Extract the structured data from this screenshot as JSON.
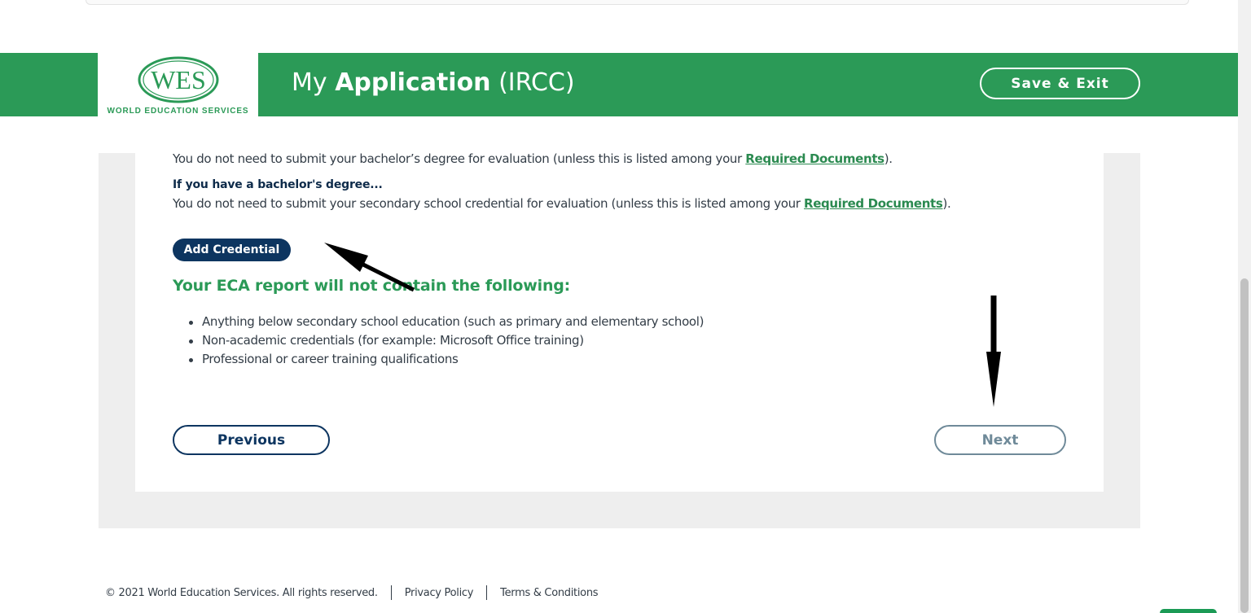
{
  "header": {
    "logo_text": "WES",
    "logo_subtitle": "WORLD EDUCATION SERVICES",
    "title_prefix": "My ",
    "title_bold": "Application",
    "title_suffix": " (IRCC)",
    "save_exit_label": "Save & Exit",
    "brand_color": "#2b9a57"
  },
  "content": {
    "line1_text": "You do not need to submit your bachelor’s degree for evaluation (unless this is listed among your ",
    "line1_link": "Required Documents",
    "line1_end": ").",
    "subhead": "If you have a bachelor's degree...",
    "line2_text": "You do not need to submit your secondary school credential for evaluation (unless this is listed among your ",
    "line2_link": "Required Documents",
    "line2_end": ").",
    "add_credential_label": "Add Credential",
    "eca_heading": "Your ECA report will not contain the following:",
    "bullets": [
      "Anything below secondary school education (such as primary and elementary school)",
      "Non-academic credentials (for example: Microsoft Office training)",
      "Professional or career training qualifications"
    ]
  },
  "nav": {
    "previous_label": "Previous",
    "next_label": "Next"
  },
  "footer": {
    "copyright": "© 2021 World Education Services. All rights reserved.",
    "privacy": "Privacy Policy",
    "terms": "Terms & Conditions"
  }
}
